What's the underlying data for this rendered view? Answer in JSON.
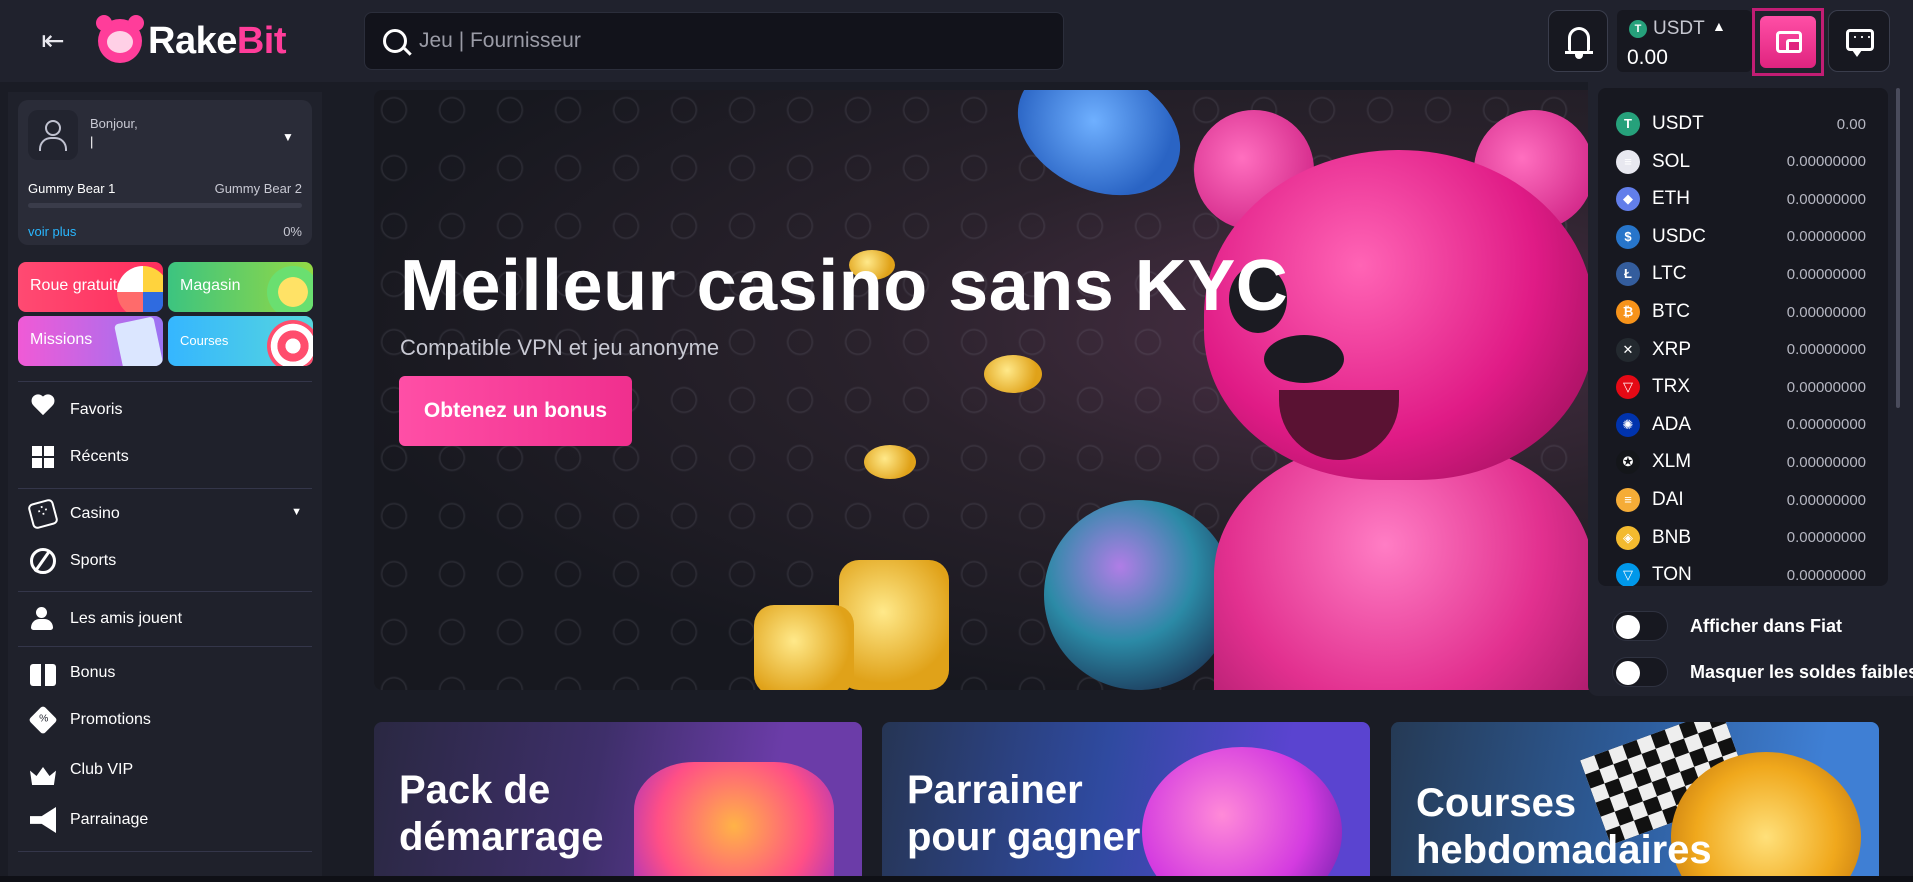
{
  "header": {
    "logo_part1": "Rake",
    "logo_part2": "Bit",
    "search_placeholder": "Jeu | Fournisseur",
    "currency": "USDT",
    "balance": "0.00"
  },
  "user": {
    "greeting": "Bonjour,",
    "name": "|",
    "level_current": "Gummy Bear 1",
    "level_next": "Gummy Bear 2",
    "see_more": "voir plus",
    "progress": "0%",
    "progress_value": 0
  },
  "tiles": [
    {
      "label": "Roue gratuite"
    },
    {
      "label": "Magasin"
    },
    {
      "label": "Missions"
    },
    {
      "label": "Courses"
    }
  ],
  "nav": {
    "favoris": "Favoris",
    "recents": "Récents",
    "casino": "Casino",
    "sports": "Sports",
    "friends": "Les amis jouent",
    "bonus": "Bonus",
    "promotions": "Promotions",
    "vip": "Club VIP",
    "parrainage": "Parrainage"
  },
  "hero": {
    "title": "Meilleur casino sans KYC",
    "subtitle": "Compatible VPN et jeu anonyme",
    "button": "Obtenez un bonus"
  },
  "promos": [
    {
      "title": "Pack de\ndémarrage"
    },
    {
      "title": "Parrainer\npour gagner"
    },
    {
      "title": "Courses\nhebdomadaires"
    }
  ],
  "wallet": {
    "currencies": [
      {
        "code": "USDT",
        "value": "0.00",
        "color": "#26a17b",
        "glyph": "T"
      },
      {
        "code": "SOL",
        "value": "0.00000000",
        "color": "#e8e8f0",
        "glyph": "≡"
      },
      {
        "code": "ETH",
        "value": "0.00000000",
        "color": "#627eea",
        "glyph": "◆"
      },
      {
        "code": "USDC",
        "value": "0.00000000",
        "color": "#2775ca",
        "glyph": "$"
      },
      {
        "code": "LTC",
        "value": "0.00000000",
        "color": "#345d9d",
        "glyph": "Ł"
      },
      {
        "code": "BTC",
        "value": "0.00000000",
        "color": "#f7931a",
        "glyph": "₿"
      },
      {
        "code": "XRP",
        "value": "0.00000000",
        "color": "#23292f",
        "glyph": "✕"
      },
      {
        "code": "TRX",
        "value": "0.00000000",
        "color": "#e50915",
        "glyph": "▽"
      },
      {
        "code": "ADA",
        "value": "0.00000000",
        "color": "#0033ad",
        "glyph": "✺"
      },
      {
        "code": "XLM",
        "value": "0.00000000",
        "color": "#14161a",
        "glyph": "✪"
      },
      {
        "code": "DAI",
        "value": "0.00000000",
        "color": "#f5ac37",
        "glyph": "≡"
      },
      {
        "code": "BNB",
        "value": "0.00000000",
        "color": "#f3ba2f",
        "glyph": "◈"
      },
      {
        "code": "TON",
        "value": "0.00000000",
        "color": "#0098ea",
        "glyph": "▽"
      }
    ],
    "toggle_fiat": "Afficher dans Fiat",
    "toggle_hide_small": "Masquer les soldes faibles"
  }
}
